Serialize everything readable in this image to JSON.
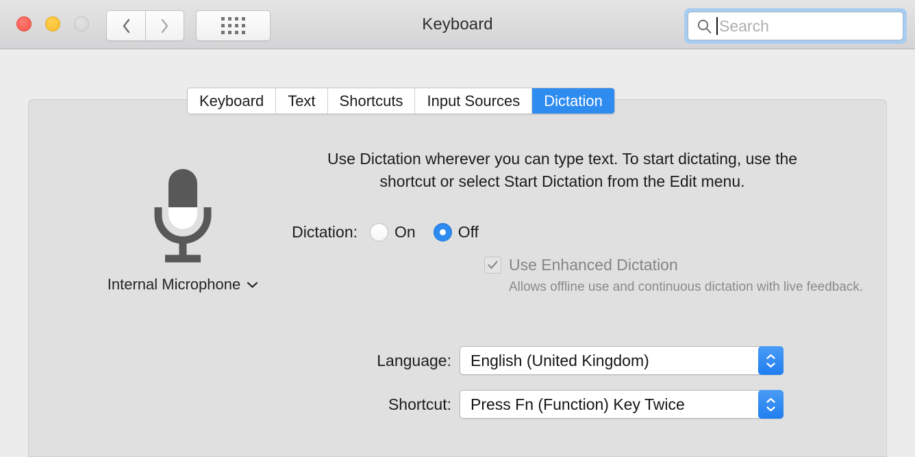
{
  "window": {
    "title": "Keyboard",
    "traffic_lights": [
      {
        "name": "close",
        "color": "#f85449"
      },
      {
        "name": "minimize",
        "color": "#f9bc2b"
      },
      {
        "name": "zoom",
        "color": "#d2d2d2"
      }
    ],
    "nav": {
      "back": "back-icon",
      "forward": "forward-icon"
    },
    "show_all": "grid-icon"
  },
  "search": {
    "placeholder": "Search",
    "value": "",
    "icon": "search-icon",
    "focused": true,
    "focus_color": "#a8cdf0"
  },
  "tabs": [
    {
      "label": "Keyboard",
      "selected": false
    },
    {
      "label": "Text",
      "selected": false
    },
    {
      "label": "Shortcuts",
      "selected": false
    },
    {
      "label": "Input Sources",
      "selected": false
    },
    {
      "label": "Dictation",
      "selected": true
    }
  ],
  "accent_color": "#2e8bf0",
  "mic": {
    "icon": "microphone-icon",
    "label": "Internal Microphone",
    "chevron": "chevron-down-icon"
  },
  "description": "Use Dictation wherever you can type text. To start dictating, use the shortcut or select Start Dictation from the Edit menu.",
  "dictation": {
    "label": "Dictation:",
    "options": [
      {
        "label": "On",
        "selected": false
      },
      {
        "label": "Off",
        "selected": true
      }
    ]
  },
  "enhanced": {
    "label": "Use Enhanced Dictation",
    "checked": true,
    "enabled": false,
    "note": "Allows offline use and continuous dictation with live feedback."
  },
  "language": {
    "label": "Language:",
    "value": "English (United Kingdom)"
  },
  "shortcut": {
    "label": "Shortcut:",
    "value": "Press Fn (Function) Key Twice"
  }
}
